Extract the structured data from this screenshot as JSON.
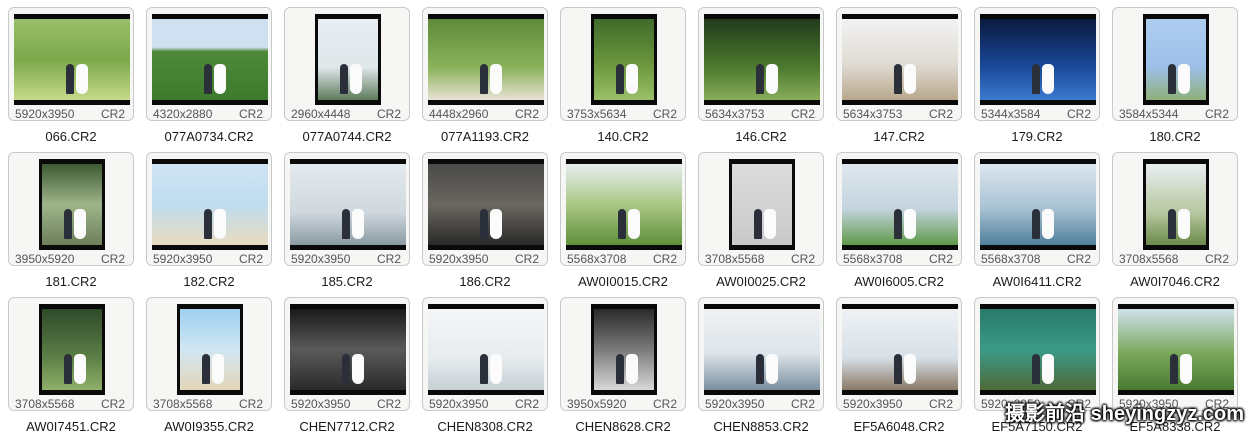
{
  "tiles": [
    {
      "dims": "5920x3950",
      "ext": "CR2",
      "name": "066.CR2",
      "orient": "land",
      "scene": "bg-garden"
    },
    {
      "dims": "4320x2880",
      "ext": "CR2",
      "name": "077A0734.CR2",
      "orient": "land",
      "scene": "bg-lawn"
    },
    {
      "dims": "2960x4448",
      "ext": "CR2",
      "name": "077A0744.CR2",
      "orient": "port",
      "scene": "bg-dark"
    },
    {
      "dims": "4448x2960",
      "ext": "CR2",
      "name": "077A1193.CR2",
      "orient": "land",
      "scene": "bg-horse"
    },
    {
      "dims": "3753x5634",
      "ext": "CR2",
      "name": "140.CR2",
      "orient": "port",
      "scene": "bg-forest"
    },
    {
      "dims": "5634x3753",
      "ext": "CR2",
      "name": "146.CR2",
      "orient": "land",
      "scene": "bg-forest2"
    },
    {
      "dims": "5634x3753",
      "ext": "CR2",
      "name": "147.CR2",
      "orient": "land",
      "scene": "bg-rocks"
    },
    {
      "dims": "5344x3584",
      "ext": "CR2",
      "name": "179.CR2",
      "orient": "land",
      "scene": "bg-night"
    },
    {
      "dims": "3584x5344",
      "ext": "CR2",
      "name": "180.CR2",
      "orient": "port",
      "scene": "bg-sky"
    },
    {
      "dims": "3950x5920",
      "ext": "CR2",
      "name": "181.CR2",
      "orient": "port",
      "scene": "bg-arch"
    },
    {
      "dims": "5920x3950",
      "ext": "CR2",
      "name": "182.CR2",
      "orient": "land",
      "scene": "bg-beach"
    },
    {
      "dims": "5920x3950",
      "ext": "CR2",
      "name": "185.CR2",
      "orient": "land",
      "scene": "bg-pier"
    },
    {
      "dims": "5920x3950",
      "ext": "CR2",
      "name": "186.CR2",
      "orient": "land",
      "scene": "bg-storm"
    },
    {
      "dims": "5568x3708",
      "ext": "CR2",
      "name": "AW0I0015.CR2",
      "orient": "land",
      "scene": "bg-meadow"
    },
    {
      "dims": "3708x5568",
      "ext": "CR2",
      "name": "AW0I0025.CR2",
      "orient": "port",
      "scene": "bg-studio"
    },
    {
      "dims": "5568x3708",
      "ext": "CR2",
      "name": "AW0I6005.CR2",
      "orient": "land",
      "scene": "bg-coast"
    },
    {
      "dims": "5568x3708",
      "ext": "CR2",
      "name": "AW0I6411.CR2",
      "orient": "land",
      "scene": "bg-lake"
    },
    {
      "dims": "3708x5568",
      "ext": "CR2",
      "name": "AW0I7046.CR2",
      "orient": "port",
      "scene": "bg-horse2"
    },
    {
      "dims": "3708x5568",
      "ext": "CR2",
      "name": "AW0I7451.CR2",
      "orient": "port",
      "scene": "bg-green2"
    },
    {
      "dims": "3708x5568",
      "ext": "CR2",
      "name": "AW0I9355.CR2",
      "orient": "port",
      "scene": "bg-sand"
    },
    {
      "dims": "5920x3950",
      "ext": "CR2",
      "name": "CHEN7712.CR2",
      "orient": "land",
      "scene": "bg-bw"
    },
    {
      "dims": "5920x3950",
      "ext": "CR2",
      "name": "CHEN8308.CR2",
      "orient": "land",
      "scene": "bg-white"
    },
    {
      "dims": "3950x5920",
      "ext": "CR2",
      "name": "CHEN8628.CR2",
      "orient": "port",
      "scene": "bg-urban"
    },
    {
      "dims": "5920x3950",
      "ext": "CR2",
      "name": "CHEN8853.CR2",
      "orient": "land",
      "scene": "bg-sea2"
    },
    {
      "dims": "5920x3950",
      "ext": "CR2",
      "name": "EF5A6048.CR2",
      "orient": "land",
      "scene": "bg-boardwalk"
    },
    {
      "dims": "5920x3950",
      "ext": "CR2",
      "name": "EF5A7150.CR2",
      "orient": "land",
      "scene": "bg-booth"
    },
    {
      "dims": "5920x3950",
      "ext": "CR2",
      "name": "EF5A8338.CR2",
      "orient": "land",
      "scene": "bg-hill"
    }
  ],
  "watermark": "摄影前沿 sheyingzyz.com"
}
